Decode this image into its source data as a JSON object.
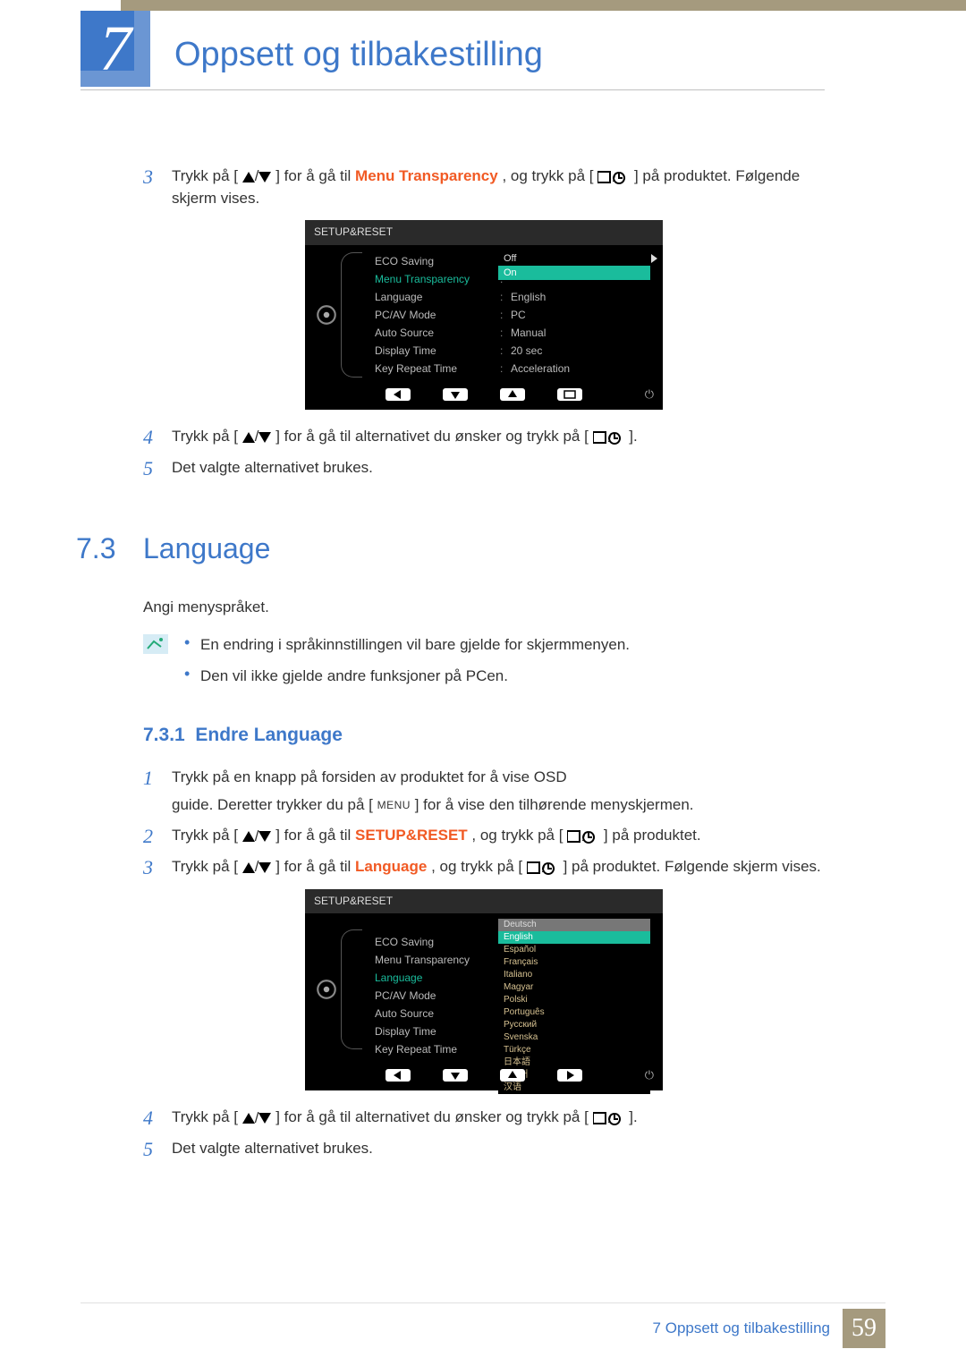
{
  "chapter": {
    "number": "7",
    "title": "Oppsett og tilbakestilling"
  },
  "steps_a": {
    "s3": {
      "num": "3",
      "t1": "Trykk på [",
      "t2": "] for å gå til ",
      "orange": "Menu Transparency",
      "t3": ", og trykk på [",
      "t4": "] på produktet. Følgende skjerm vises."
    },
    "s4": {
      "num": "4",
      "t1": "Trykk på [",
      "t2": "] for å gå til alternativet du ønsker og trykk på [",
      "t3": "]."
    },
    "s5": {
      "num": "5",
      "text": "Det valgte alternativet brukes."
    }
  },
  "osd1": {
    "title": "SETUP&RESET",
    "rows": [
      {
        "label": "ECO Saving",
        "value": ""
      },
      {
        "label": "Menu Transparency",
        "value": "",
        "highlight": true
      },
      {
        "label": "Language",
        "value": "English"
      },
      {
        "label": "PC/AV Mode",
        "value": "PC"
      },
      {
        "label": "Auto Source",
        "value": "Manual"
      },
      {
        "label": "Display Time",
        "value": "20 sec"
      },
      {
        "label": "Key Repeat Time",
        "value": "Acceleration"
      }
    ],
    "dropdown": {
      "options": [
        "Off",
        "On"
      ],
      "selected": "On"
    }
  },
  "section73": {
    "num": "7.3",
    "title": "Language",
    "para": "Angi menyspråket.",
    "notes": [
      "En endring i språkinnstillingen vil bare gjelde for skjermmenyen.",
      "Den vil ikke gjelde andre funksjoner på PCen."
    ],
    "subhead_num": "7.3.1",
    "subhead_title": "Endre Language"
  },
  "steps_b": {
    "s1": {
      "num": "1",
      "line1": "Trykk på en knapp på forsiden av produktet for å vise OSD",
      "line2a": "guide. Deretter trykker du på [",
      "menu": "MENU",
      "line2b": "] for å vise den tilhørende menyskjermen."
    },
    "s2": {
      "num": "2",
      "t1": "Trykk på [",
      "t2": "] for å gå til ",
      "orange": "SETUP&RESET",
      "t3": ", og trykk på [",
      "t4": "] på produktet."
    },
    "s3": {
      "num": "3",
      "t1": "Trykk på [",
      "t2": "] for å gå til ",
      "orange": "Language",
      "t3": ", og trykk på [",
      "t4": "] på produktet. Følgende skjerm vises."
    },
    "s4": {
      "num": "4",
      "t1": "Trykk på [",
      "t2": "] for å gå til alternativet du ønsker og trykk på [",
      "t3": "]."
    },
    "s5": {
      "num": "5",
      "text": "Det valgte alternativet brukes."
    }
  },
  "osd2": {
    "title": "SETUP&RESET",
    "rows": [
      {
        "label": "ECO Saving"
      },
      {
        "label": "Menu Transparency"
      },
      {
        "label": "Language",
        "highlight": true
      },
      {
        "label": "PC/AV Mode"
      },
      {
        "label": "Auto Source"
      },
      {
        "label": "Display Time"
      },
      {
        "label": "Key Repeat Time"
      }
    ],
    "langlist": {
      "options": [
        "Deutsch",
        "English",
        "Español",
        "Français",
        "Italiano",
        "Magyar",
        "Polski",
        "Português",
        "Русский",
        "Svenska",
        "Türkçe",
        "日本語",
        "한국어",
        "汉语"
      ],
      "selected": "English",
      "header": "Deutsch"
    }
  },
  "footer": {
    "text": "7 Oppsett og tilbakestilling",
    "page": "59"
  }
}
